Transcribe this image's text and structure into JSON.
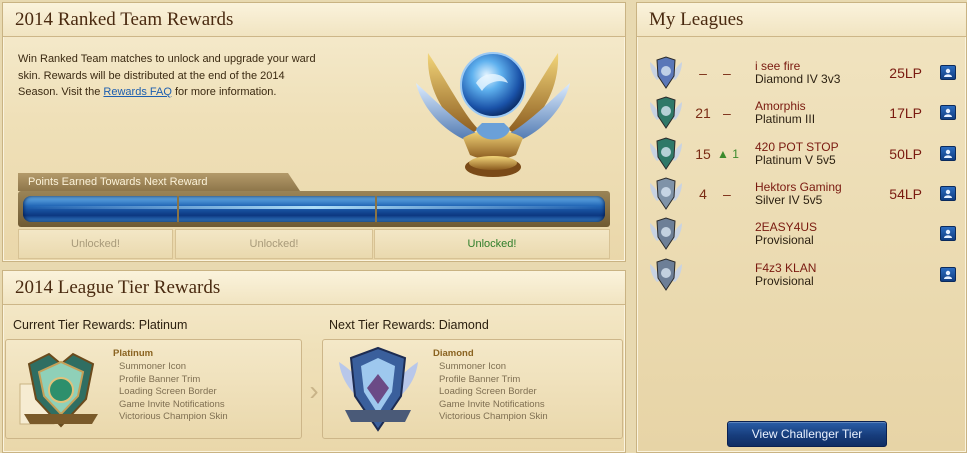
{
  "ranked": {
    "title": "2014 Ranked Team Rewards",
    "description_pre": "Win Ranked Team matches to unlock and upgrade your ward skin. Rewards will be distributed at the end of the 2014 Season. Visit the",
    "faq_link": "Rewards FAQ",
    "description_post": "for more information.",
    "progress_label": "Points Earned Towards Next Reward",
    "progress_fraction": 1.0,
    "slots": [
      {
        "label": "Unlocked!",
        "state": "dim"
      },
      {
        "label": "Unlocked!",
        "state": "dim"
      },
      {
        "label": "Unlocked!",
        "state": "active"
      }
    ]
  },
  "tier": {
    "title": "2014 League Tier Rewards",
    "current_label": "Current Tier Rewards: Platinum",
    "next_label": "Next Tier Rewards: Diamond",
    "current": {
      "name": "Platinum",
      "items": [
        "Summoner Icon",
        "Profile Banner Trim",
        "Loading Screen Border",
        "Game Invite Notifications",
        "Victorious Champion Skin"
      ]
    },
    "next": {
      "name": "Diamond",
      "items": [
        "Summoner Icon",
        "Profile Banner Trim",
        "Loading Screen Border",
        "Game Invite Notifications",
        "Victorious Champion Skin"
      ]
    }
  },
  "leagues": {
    "title": "My Leagues",
    "rows": [
      {
        "rank": "–",
        "move": "",
        "dash": "–",
        "name": "i see fire",
        "sub": "Diamond IV 3v3",
        "lp": "25LP",
        "tier": "diamond"
      },
      {
        "rank": "21",
        "move": "",
        "dash": "–",
        "name": "Amorphis",
        "sub": "Platinum III",
        "lp": "17LP",
        "tier": "platinum"
      },
      {
        "rank": "15",
        "move": "1",
        "dash": "",
        "name": "420 POT STOP",
        "sub": "Platinum V 5v5",
        "lp": "50LP",
        "tier": "platinum"
      },
      {
        "rank": "4",
        "move": "",
        "dash": "–",
        "name": "Hektors Gaming",
        "sub": "Silver IV 5v5",
        "lp": "54LP",
        "tier": "silver"
      },
      {
        "rank": "",
        "move": "",
        "dash": "",
        "name": "2EASY4US",
        "sub": "Provisional",
        "lp": "",
        "tier": "provisional"
      },
      {
        "rank": "",
        "move": "",
        "dash": "",
        "name": "F4z3 KLAN",
        "sub": "Provisional",
        "lp": "",
        "tier": "provisional"
      }
    ],
    "challenger_button": "View Challenger Tier"
  },
  "colors": {
    "panel_bg": "#f1e4c1",
    "title_text": "#4a2a10",
    "league_name": "#7a1a10",
    "progress_blue": "#1e62b3",
    "button_blue": "#173d7c",
    "unlocked_green": "#2f7e2a"
  },
  "icons": [
    "ward-trophy-icon",
    "platinum-emblem-icon",
    "diamond-emblem-icon",
    "league-badge-icon",
    "profile-button-icon",
    "arrow-up-icon"
  ]
}
